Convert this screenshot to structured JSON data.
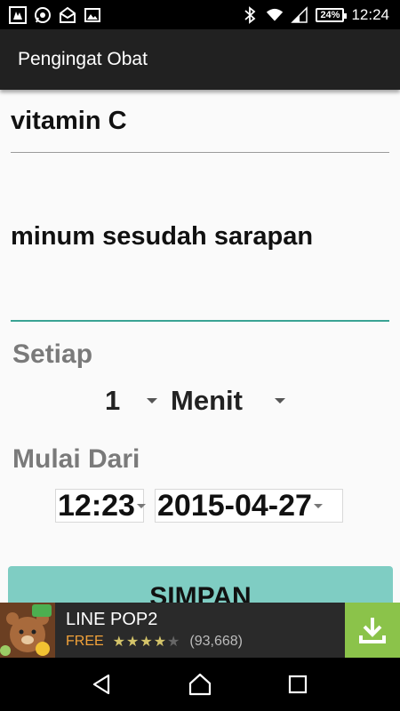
{
  "status_bar": {
    "time": "12:24",
    "battery": "24%"
  },
  "app_bar": {
    "title": "Pengingat Obat"
  },
  "form": {
    "medicine_name": "vitamin C",
    "note": "minum sesudah sarapan",
    "interval_label": "Setiap",
    "interval_value": "1",
    "interval_unit": "Menit",
    "start_label": "Mulai Dari",
    "start_time": "12:23",
    "start_date": "2015-04-27",
    "save_label": "SIMPAN"
  },
  "ad": {
    "title": "LINE POP2",
    "price": "FREE",
    "stars": "★★★★★",
    "rating": 4.5,
    "review_count": "(93,668)"
  },
  "colors": {
    "accent": "#3aa394",
    "button": "#7fcdc3",
    "download": "#8bc34a",
    "appbar": "#212121"
  }
}
